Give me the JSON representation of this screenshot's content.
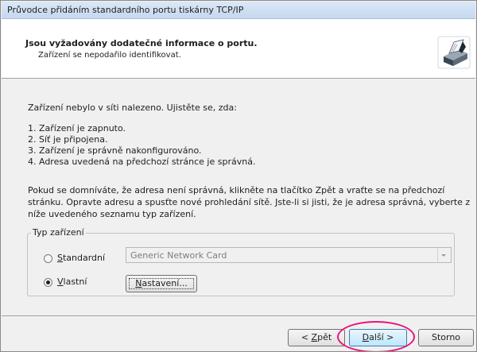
{
  "window": {
    "title": "Průvodce přidáním standardního portu tiskárny TCP/IP"
  },
  "header": {
    "title": "Jsou vyžadovány dodatečné informace o portu.",
    "subtitle": "Zařízení se nepodařilo identifikovat.",
    "icon": "printer-wizard-icon"
  },
  "body": {
    "intro": "Zařízení nebylo v síti nalezeno. Ujistěte se, zda:",
    "checklist": [
      "1.  Zařízení je zapnuto.",
      "2.  Síť je připojena.",
      "3.  Zařízení je správně nakonfigurováno.",
      "4.  Adresa uvedená na předchozí stránce je správná."
    ],
    "paragraph": [
      "Pokud se domníváte, že adresa není správná, klikněte na tlačítko Zpět a vraťte se na předchozí",
      "stránku. Opravte adresu a spusťte nové prohledání sítě. Jste-li si jisti, že je adresa správná, vyberte z",
      "níže uvedeného seznamu typ zařízení."
    ]
  },
  "device_type": {
    "legend": "Typ zařízení",
    "standard": {
      "label_key": "S",
      "label_rest": "tandardní",
      "selected": false,
      "combo_value": "Generic Network Card"
    },
    "custom": {
      "label_key": "V",
      "label_rest": "lastní",
      "selected": true,
      "settings_key": "N",
      "settings_rest": "astavení..."
    }
  },
  "footer": {
    "back_prefix": "< ",
    "back_key": "Z",
    "back_rest": "pět",
    "next_key": "D",
    "next_rest": "alší >",
    "cancel": "Storno"
  },
  "colors": {
    "highlight": "#e6147a",
    "default_button_border": "#3c7fb1"
  }
}
